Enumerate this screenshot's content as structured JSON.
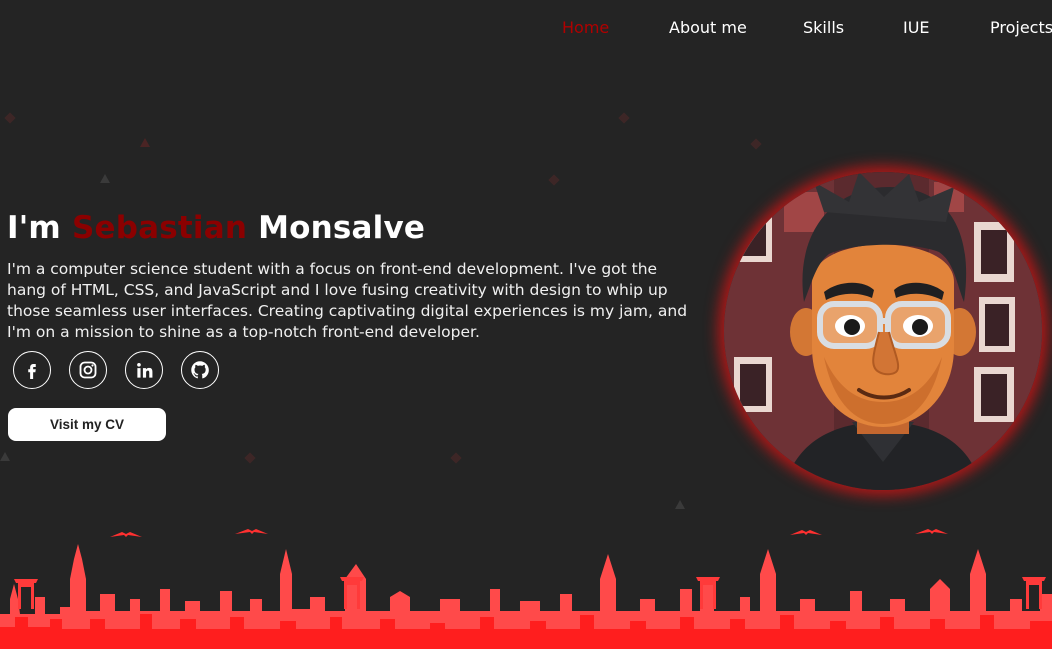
{
  "nav": {
    "items": [
      {
        "label": "Home",
        "active": true
      },
      {
        "label": "About me",
        "active": false
      },
      {
        "label": "Skills",
        "active": false
      },
      {
        "label": "IUE",
        "active": false
      },
      {
        "label": "Projects",
        "active": false
      }
    ]
  },
  "hero": {
    "title_prefix": "I'm",
    "first_name": "Sebastian",
    "last_name": "Monsalve",
    "description": "I'm a computer science student with a focus on front-end development. I've got the hang of HTML, CSS, and JavaScript and I love fusing creativity with design to whip up those seamless user interfaces. Creating captivating digital experiences is my jam, and I'm on a mission to shine as a top-notch front-end developer.",
    "cv_button": "Visit my CV"
  },
  "socials": [
    {
      "icon": "facebook-icon"
    },
    {
      "icon": "instagram-icon"
    },
    {
      "icon": "linkedin-icon"
    },
    {
      "icon": "github-icon"
    }
  ],
  "colors": {
    "background": "#242424",
    "accent": "#8b0000",
    "nav_active": "#b00000",
    "skyline": "#ff2a2a",
    "avatar_glow": "#dc1414"
  }
}
